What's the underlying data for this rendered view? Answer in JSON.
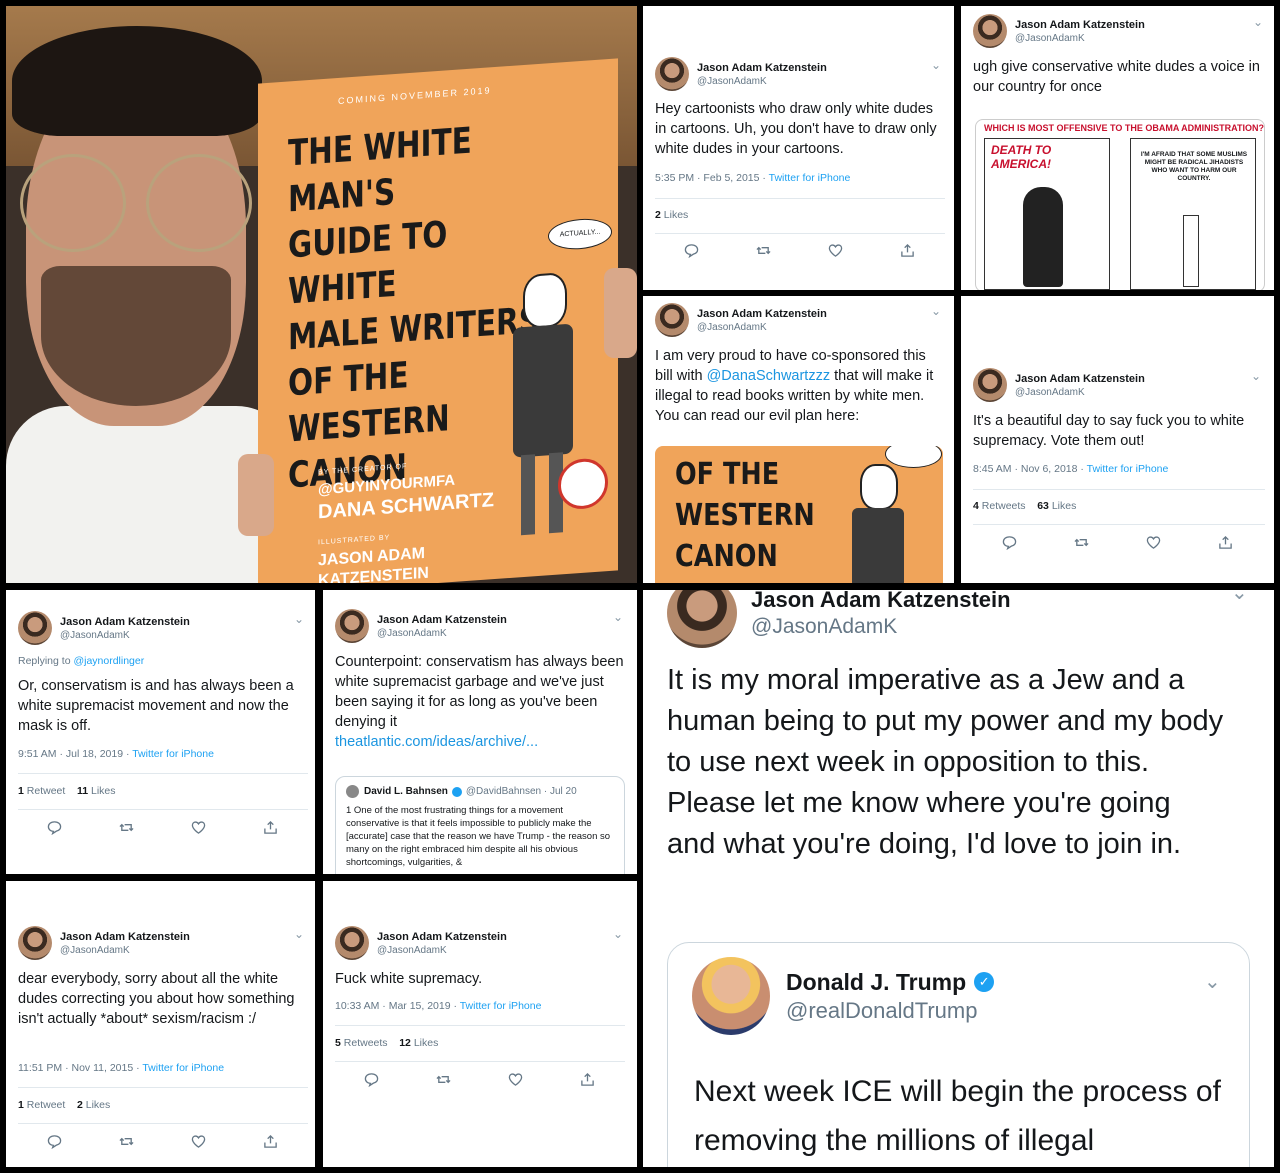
{
  "account": {
    "name": "Jason Adam Katzenstein",
    "handle": "@JasonAdamK"
  },
  "book": {
    "coming": "COMING NOVEMBER 2019",
    "title_lines": [
      "THE WHITE MAN'S",
      "GUIDE TO WHITE",
      "MALE WRITERS",
      "OF THE",
      "WESTERN",
      "CANON"
    ],
    "creator_label": "BY THE CREATOR OF",
    "creator_handle": "@GUYINYOURMFA",
    "author": "DANA SCHWARTZ",
    "illustrated_label": "ILLUSTRATED BY",
    "illustrator": "JASON ADAM KATZENSTEIN",
    "bubble": "ACTUALLY..."
  },
  "tweets": {
    "t1": {
      "text": "Hey cartoonists who draw only white dudes in cartoons. Uh, you don't have to draw only white dudes in your cartoons.",
      "time": "5:35 PM · Feb 5, 2015 ·",
      "source": "Twitter for iPhone",
      "likes_n": "2",
      "likes_l": "Likes"
    },
    "t2": {
      "text": "ugh give conservative white dudes a voice in our country for once",
      "cartoon_header": "WHICH IS MOST OFFENSIVE TO THE OBAMA ADMINISTRATION?",
      "cartoon_left": "DEATH TO AMERICA!",
      "cartoon_right": "I'M AFRAID THAT SOME MUSLIMS MIGHT BE RADICAL JIHADISTS WHO WANT TO HARM OUR COUNTRY."
    },
    "t3": {
      "text_a": "I am very proud to have co-sponsored this bill with ",
      "mention": "@DanaSchwartzzz",
      "text_b": " that will make it illegal to read books written by white men. You can read our evil plan here:",
      "img_lines": [
        "OF THE",
        "WESTERN",
        "CANON"
      ]
    },
    "t4": {
      "text": "It's a beautiful day to say fuck you to white supremacy. Vote them out!",
      "time": "8:45 AM · Nov 6, 2018 ·",
      "source": "Twitter for iPhone",
      "rt_n": "4",
      "rt_l": "Retweets",
      "likes_n": "63",
      "likes_l": "Likes"
    },
    "t5": {
      "replying": "Replying to ",
      "reply_to": "@jaynordlinger",
      "text": "Or, conservatism is and has always been a white supremacist movement and now the mask is off.",
      "time": "9:51 AM · Jul 18, 2019 ·",
      "source": "Twitter for iPhone",
      "rt_n": "1",
      "rt_l": "Retweet",
      "likes_n": "11",
      "likes_l": "Likes"
    },
    "t6": {
      "text": "Counterpoint: conservatism has always been white supremacist garbage and we've just been saying it for as long as you've been denying it",
      "link": "theatlantic.com/ideas/archive/...",
      "quote": {
        "name": "David L. Bahnsen",
        "handle": "@DavidBahnsen · Jul 20",
        "text": "1 One of the most frustrating things for a movement conservative is that it feels impossible to publicly make the [accurate] case that the reason we have Trump - the reason so many on the right embraced him despite all his obvious shortcomings, vulgarities, &"
      }
    },
    "t7": {
      "text": "dear everybody, sorry about all the white dudes correcting you about how something isn't actually *about* sexism/racism :/",
      "time": "11:51 PM · Nov 11, 2015 ·",
      "source": "Twitter for iPhone",
      "rt_n": "1",
      "rt_l": "Retweet",
      "likes_n": "2",
      "likes_l": "Likes"
    },
    "t8": {
      "text": "Fuck white supremacy.",
      "time": "10:33 AM · Mar 15, 2019 ·",
      "source": "Twitter for iPhone",
      "rt_n": "5",
      "rt_l": "Retweets",
      "likes_n": "12",
      "likes_l": "Likes"
    },
    "t9": {
      "text": "It is my moral imperative as a Jew and a human being to put my power and my body to use next week in opposition to this. Please let me know where you're going and what you're doing, I'd love to join in.",
      "quote": {
        "name": "Donald J. Trump",
        "handle": "@realDonaldTrump",
        "text": "Next week ICE will begin the process of removing the millions of illegal"
      }
    }
  },
  "colors": {
    "book": "#f0a45a",
    "link": "#1da1f2",
    "verified": "#1da1f2"
  },
  "icons": [
    "reply-icon",
    "retweet-icon",
    "like-icon",
    "share-icon",
    "chevron-down-icon",
    "verified-icon"
  ]
}
